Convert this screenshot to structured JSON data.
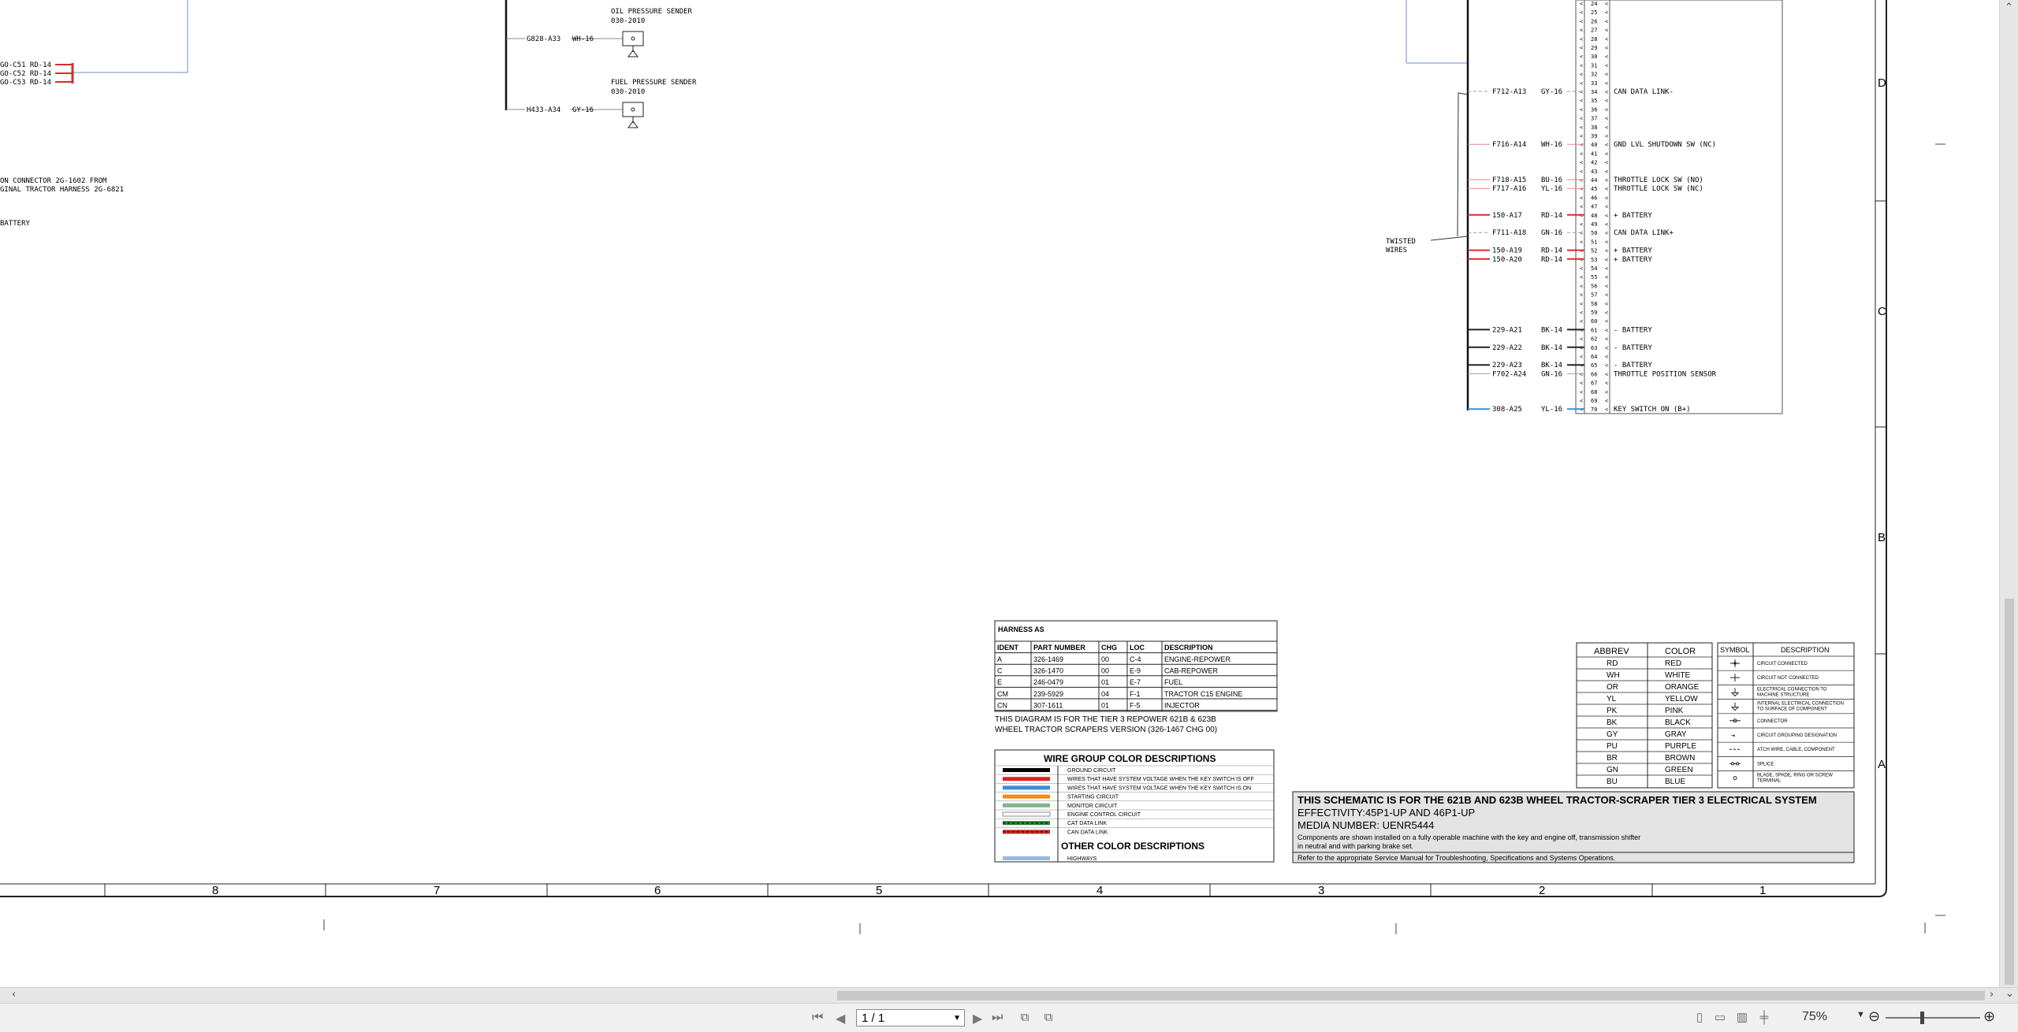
{
  "schematic": {
    "left_wires": [
      {
        "label": "GO-C51 RD-14"
      },
      {
        "label": "GO-C52 RD-14"
      },
      {
        "label": "GO-C53 RD-14"
      }
    ],
    "left_note": [
      "ON CONNECTOR 2G-1602 FROM",
      "GINAL TRACTOR HARNESS 2G-6821"
    ],
    "left_battery": "BATTERY",
    "oil_sender": {
      "title": "OIL PRESSURE SENDER",
      "part": "030-2010",
      "wire": "G828-A33",
      "color": "WH-16"
    },
    "fuel_sender": {
      "title": "FUEL PRESSURE SENDER",
      "part": "030-2010",
      "wire": "H433-A34",
      "color": "GY-16"
    },
    "twisted_wires": [
      "TWISTED",
      "WIRES"
    ],
    "pins_top": [
      "24",
      "25",
      "26",
      "27",
      "28",
      "29",
      "30",
      "31",
      "32",
      "33"
    ],
    "pin_rows": [
      {
        "pin": "34",
        "wire": "F712-A13",
        "color": "GY-16",
        "desc": "CAN DATA LINK-"
      },
      {
        "pin": "35"
      },
      {
        "pin": "36"
      },
      {
        "pin": "37"
      },
      {
        "pin": "38"
      },
      {
        "pin": "39"
      },
      {
        "pin": "40",
        "wire": "F716-A14",
        "color": "WH-16",
        "desc": "GND LVL SHUTDOWN SW (NC)"
      },
      {
        "pin": "41"
      },
      {
        "pin": "42"
      },
      {
        "pin": "43"
      },
      {
        "pin": "44",
        "wire": "F718-A15",
        "color": "BU-16",
        "desc": "THROTTLE LOCK SW (NO)"
      },
      {
        "pin": "45",
        "wire": "F717-A16",
        "color": "YL-16",
        "desc": "THROTTLE LOCK SW (NC)"
      },
      {
        "pin": "46"
      },
      {
        "pin": "47"
      },
      {
        "pin": "48",
        "wire": "150-A17",
        "color": "RD-14",
        "desc": "+ BATTERY"
      },
      {
        "pin": "49"
      },
      {
        "pin": "50",
        "wire": "F711-A18",
        "color": "GN-16",
        "desc": "CAN DATA LINK+"
      },
      {
        "pin": "51"
      },
      {
        "pin": "52",
        "wire": "150-A19",
        "color": "RD-14",
        "desc": "+ BATTERY"
      },
      {
        "pin": "53",
        "wire": "150-A20",
        "color": "RD-14",
        "desc": "+ BATTERY"
      },
      {
        "pin": "54"
      },
      {
        "pin": "55"
      },
      {
        "pin": "56"
      },
      {
        "pin": "57"
      },
      {
        "pin": "58"
      },
      {
        "pin": "59"
      },
      {
        "pin": "60"
      },
      {
        "pin": "61",
        "wire": "229-A21",
        "color": "BK-14",
        "desc": "- BATTERY"
      },
      {
        "pin": "62"
      },
      {
        "pin": "63",
        "wire": "229-A22",
        "color": "BK-14",
        "desc": "- BATTERY"
      },
      {
        "pin": "64"
      },
      {
        "pin": "65",
        "wire": "229-A23",
        "color": "BK-14",
        "desc": "- BATTERY"
      },
      {
        "pin": "66",
        "wire": "F702-A24",
        "color": "GN-16",
        "desc": "THROTTLE POSITION SENSOR"
      },
      {
        "pin": "67"
      },
      {
        "pin": "68"
      },
      {
        "pin": "69"
      },
      {
        "pin": "70",
        "wire": "308-A25",
        "color": "YL-16",
        "desc": "KEY SWITCH ON (B+)"
      }
    ],
    "zone_letters": [
      "D",
      "C",
      "B",
      "A"
    ],
    "column_numbers": [
      "8",
      "7",
      "6",
      "5",
      "4",
      "3",
      "2",
      "1"
    ],
    "harness_table": {
      "title": "HARNESS AS",
      "headers": [
        "IDENT",
        "PART NUMBER",
        "CHG",
        "LOC",
        "DESCRIPTION"
      ],
      "rows": [
        [
          "A",
          "326-1469",
          "00",
          "C-4",
          "ENGINE-REPOWER"
        ],
        [
          "C",
          "326-1470",
          "00",
          "E-9",
          "CAB-REPOWER"
        ],
        [
          "E",
          "246-0479",
          "01",
          "E-7",
          "FUEL"
        ],
        [
          "CM",
          "239-5929",
          "04",
          "F-1",
          "TRACTOR C15 ENGINE"
        ],
        [
          "CN",
          "307-1611",
          "01",
          "F-5",
          "INJECTOR"
        ]
      ],
      "note": [
        "THIS DIAGRAM IS FOR THE TIER 3 REPOWER 621B & 623B",
        "WHEEL TRACTOR SCRAPERS VERSION (326-1467 CHG 00)"
      ]
    },
    "wire_group": {
      "title": "WIRE GROUP COLOR DESCRIPTIONS",
      "rows": [
        {
          "label": "GROUND CIRCUIT",
          "color": "#000000"
        },
        {
          "label": "WIRES THAT HAVE SYSTEM VOLTAGE WHEN THE KEY SWITCH IS OFF",
          "color": "#e02020"
        },
        {
          "label": "WIRES THAT HAVE SYSTEM VOLTAGE WHEN THE KEY SWITCH IS ON",
          "color": "#3a8fd8"
        },
        {
          "label": "STARTING CIRCUIT",
          "color": "#f08a1c"
        },
        {
          "label": "MONITOR CIRCUIT",
          "color": "#7fb48a"
        },
        {
          "label": "ENGINE CONTROL CIRCUIT",
          "color": "#ffffff"
        },
        {
          "label": "CAT DATA LINK",
          "color": "#2e7d32"
        },
        {
          "label": "CAN DATA LINK",
          "color": "#c62828"
        }
      ],
      "other_title": "OTHER COLOR DESCRIPTIONS",
      "other_rows": [
        {
          "label": "HIGHWAYS",
          "color": "#9bb8e3"
        }
      ]
    },
    "abbrev_table": {
      "headers": [
        "ABBREV",
        "COLOR"
      ],
      "rows": [
        [
          "RD",
          "RED"
        ],
        [
          "WH",
          "WHITE"
        ],
        [
          "OR",
          "ORANGE"
        ],
        [
          "YL",
          "YELLOW"
        ],
        [
          "PK",
          "PINK"
        ],
        [
          "BK",
          "BLACK"
        ],
        [
          "GY",
          "GRAY"
        ],
        [
          "PU",
          "PURPLE"
        ],
        [
          "BR",
          "BROWN"
        ],
        [
          "GN",
          "GREEN"
        ],
        [
          "BU",
          "BLUE"
        ]
      ]
    },
    "symbol_table": {
      "headers": [
        "SYMBOL",
        "DESCRIPTION"
      ],
      "rows": [
        {
          "symbol": "connected-dot",
          "desc": "CIRCUIT CONNECTED"
        },
        {
          "symbol": "crossing",
          "desc": "CIRCUIT NOT CONNECTED"
        },
        {
          "symbol": "ground",
          "desc": "ELECTRICAL CONNECTION TO MACHINE STRUCTURE"
        },
        {
          "symbol": "internal-ground",
          "desc": "INTERNAL ELECTRICAL CONNECTION TO SURFACE OF COMPONENT"
        },
        {
          "symbol": "connector",
          "desc": "CONNECTOR"
        },
        {
          "symbol": "group",
          "desc": "CIRCUIT GROUPING DESIGNATION"
        },
        {
          "symbol": "dash",
          "desc": "ATCH WIRE, CABLE, COMPONENT"
        },
        {
          "symbol": "splice",
          "desc": "SPLICE"
        },
        {
          "symbol": "terminal",
          "desc": "BLADE, SPADE, RING OR SCREW TERMINAL"
        }
      ]
    },
    "title_block": {
      "heading": "THIS SCHEMATIC IS FOR THE 621B AND 623B WHEEL TRACTOR-SCRAPER TIER 3 ELECTRICAL SYSTEM",
      "effectivity": "EFFECTIVITY:45P1-UP AND 46P1-UP",
      "media": "MEDIA NUMBER: UENR5444",
      "note1": "Components are shown installed on a fully operable machine with the key and engine off, transmission shifter",
      "note2": "in neutral and with parking brake set.",
      "note3": "Refer to the appropriate Service Manual for Troubleshooting, Specifications and Systems Operations."
    }
  },
  "statusbar": {
    "page_value": "1 / 1",
    "zoom": "75%",
    "icons": [
      "first-page-icon",
      "prev-page-icon",
      "next-page-icon",
      "last-page-icon",
      "fit-width-icon",
      "fit-page-icon"
    ]
  }
}
